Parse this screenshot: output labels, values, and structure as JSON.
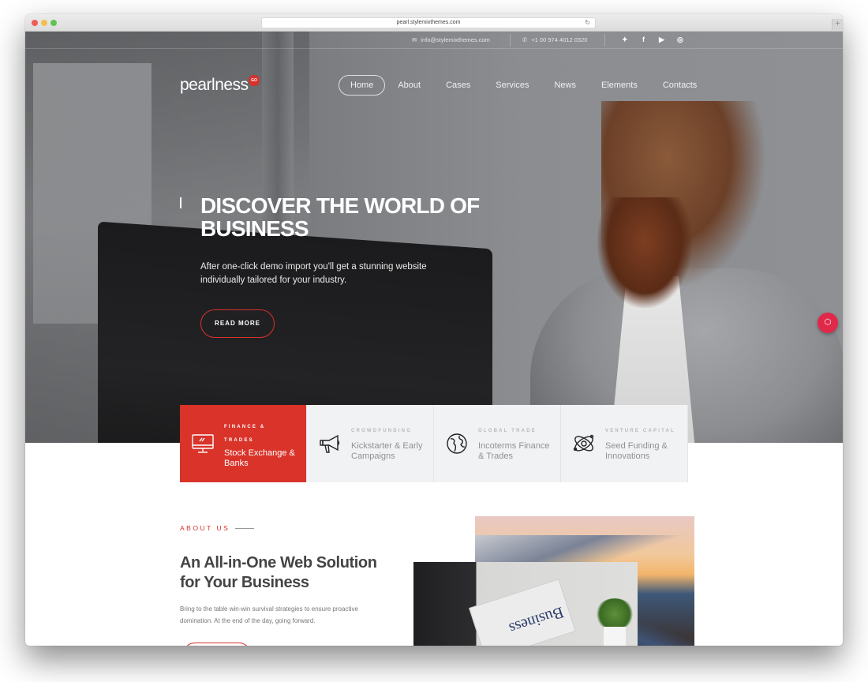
{
  "browser": {
    "url": "pearl.stylemixthemes.com",
    "reload_icon": "↻",
    "new_tab_icon": "+"
  },
  "topbar": {
    "email": "info@stylemixthemes.com",
    "phone": "+1 00 974 4012 0320",
    "email_icon": "✉",
    "phone_icon": "✆",
    "social": [
      {
        "name": "twitter",
        "glyph": "🐦︎"
      },
      {
        "name": "facebook",
        "glyph": "f"
      },
      {
        "name": "youtube",
        "glyph": "▶"
      },
      {
        "name": "instagram",
        "glyph": "◎"
      }
    ]
  },
  "logo": {
    "text": "pearlness",
    "badge": "GO"
  },
  "nav": {
    "items": [
      "Home",
      "About",
      "Cases",
      "Services",
      "News",
      "Elements",
      "Contacts"
    ],
    "active": "Home"
  },
  "hero": {
    "title": "DISCOVER THE WORLD OF BUSINESS",
    "subtitle": "After one-click demo import you'll get a stunning website individually tailored for your industry.",
    "button": "READ MORE",
    "fab_icon": "⬡"
  },
  "services": [
    {
      "category": "FINANCE & TRADES",
      "title": "Stock Exchange & Banks",
      "icon": "monitor-icon",
      "active": true
    },
    {
      "category": "CROWDFUNDING",
      "title": "Kickstarter & Early Campaigns",
      "icon": "megaphone-icon",
      "active": false
    },
    {
      "category": "GLOBAL TRADE",
      "title": "Incoterms Finance & Trades",
      "icon": "globe-icon",
      "active": false
    },
    {
      "category": "VENTURE CAPITAL",
      "title": "Seed Funding & Innovations",
      "icon": "atom-icon",
      "active": false
    }
  ],
  "about": {
    "label": "ABOUT US",
    "title": "An All-in-One Web Solution for Your Business",
    "text": "Bring to the table win-win survival strategies to ensure proactive domination. At the end of the day, going forward.",
    "newspaper_text": "Business"
  },
  "colors": {
    "accent": "#d9332a",
    "fab": "#e0294a",
    "card_bg": "#f1f2f4"
  }
}
